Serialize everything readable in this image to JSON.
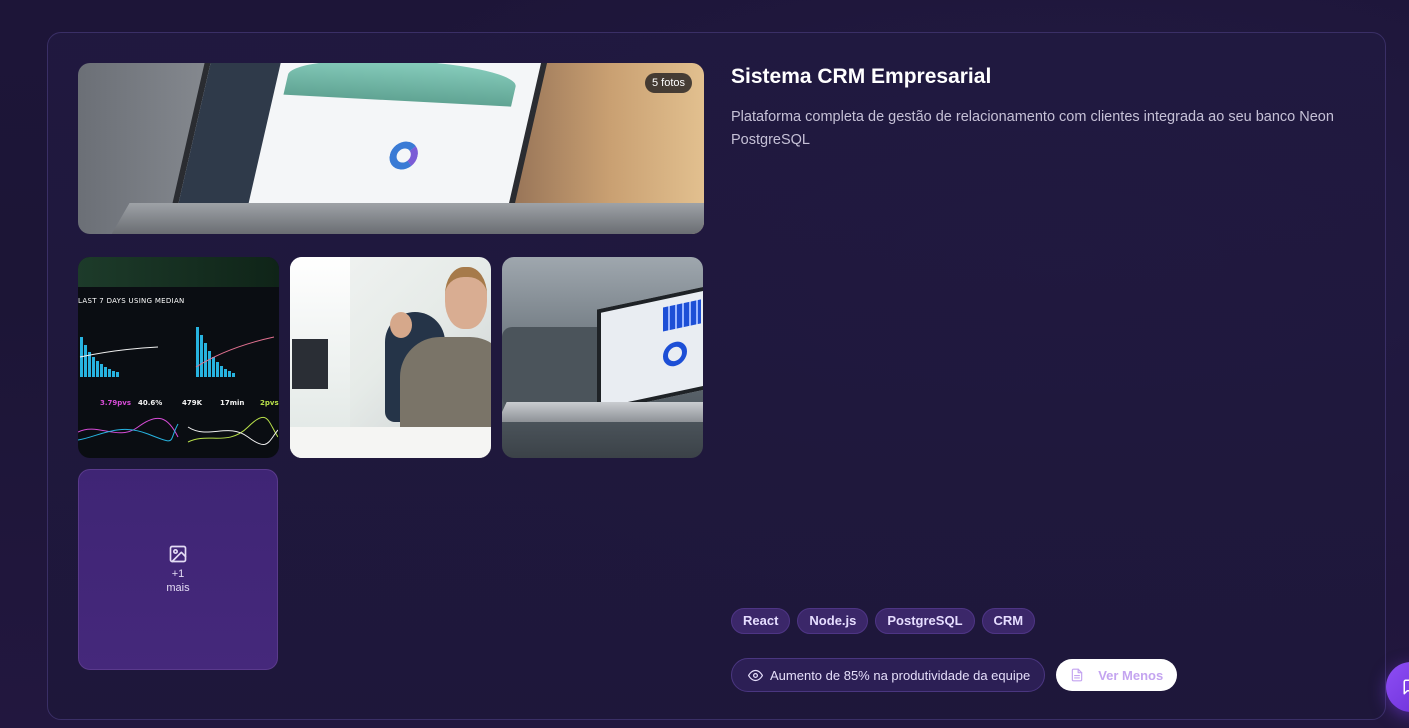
{
  "gallery": {
    "photo_count_badge": "5 fotos",
    "thumb1_caption": "LAST 7 DAYS USING MEDIAN",
    "thumb1_stats": [
      "3.79pvs",
      "40.6%",
      "479K",
      "17min",
      "2pvs"
    ],
    "more_count": "+1",
    "more_label": "mais"
  },
  "project": {
    "title": "Sistema CRM Empresarial",
    "description": "Plataforma completa de gestão de relacionamento com clientes integrada ao seu banco Neon PostgreSQL",
    "tags": [
      "React",
      "Node.js",
      "PostgreSQL",
      "CRM"
    ],
    "metric": "Aumento de 85% na produtividade da equipe",
    "toggle_label": "Ver Menos"
  },
  "colors": {
    "accent": "#8e4ef5",
    "tag_bg": "#3b2769",
    "card_border": "#3a2f66"
  },
  "icons": [
    "image-icon",
    "eye-icon",
    "document-icon",
    "chat-icon"
  ]
}
